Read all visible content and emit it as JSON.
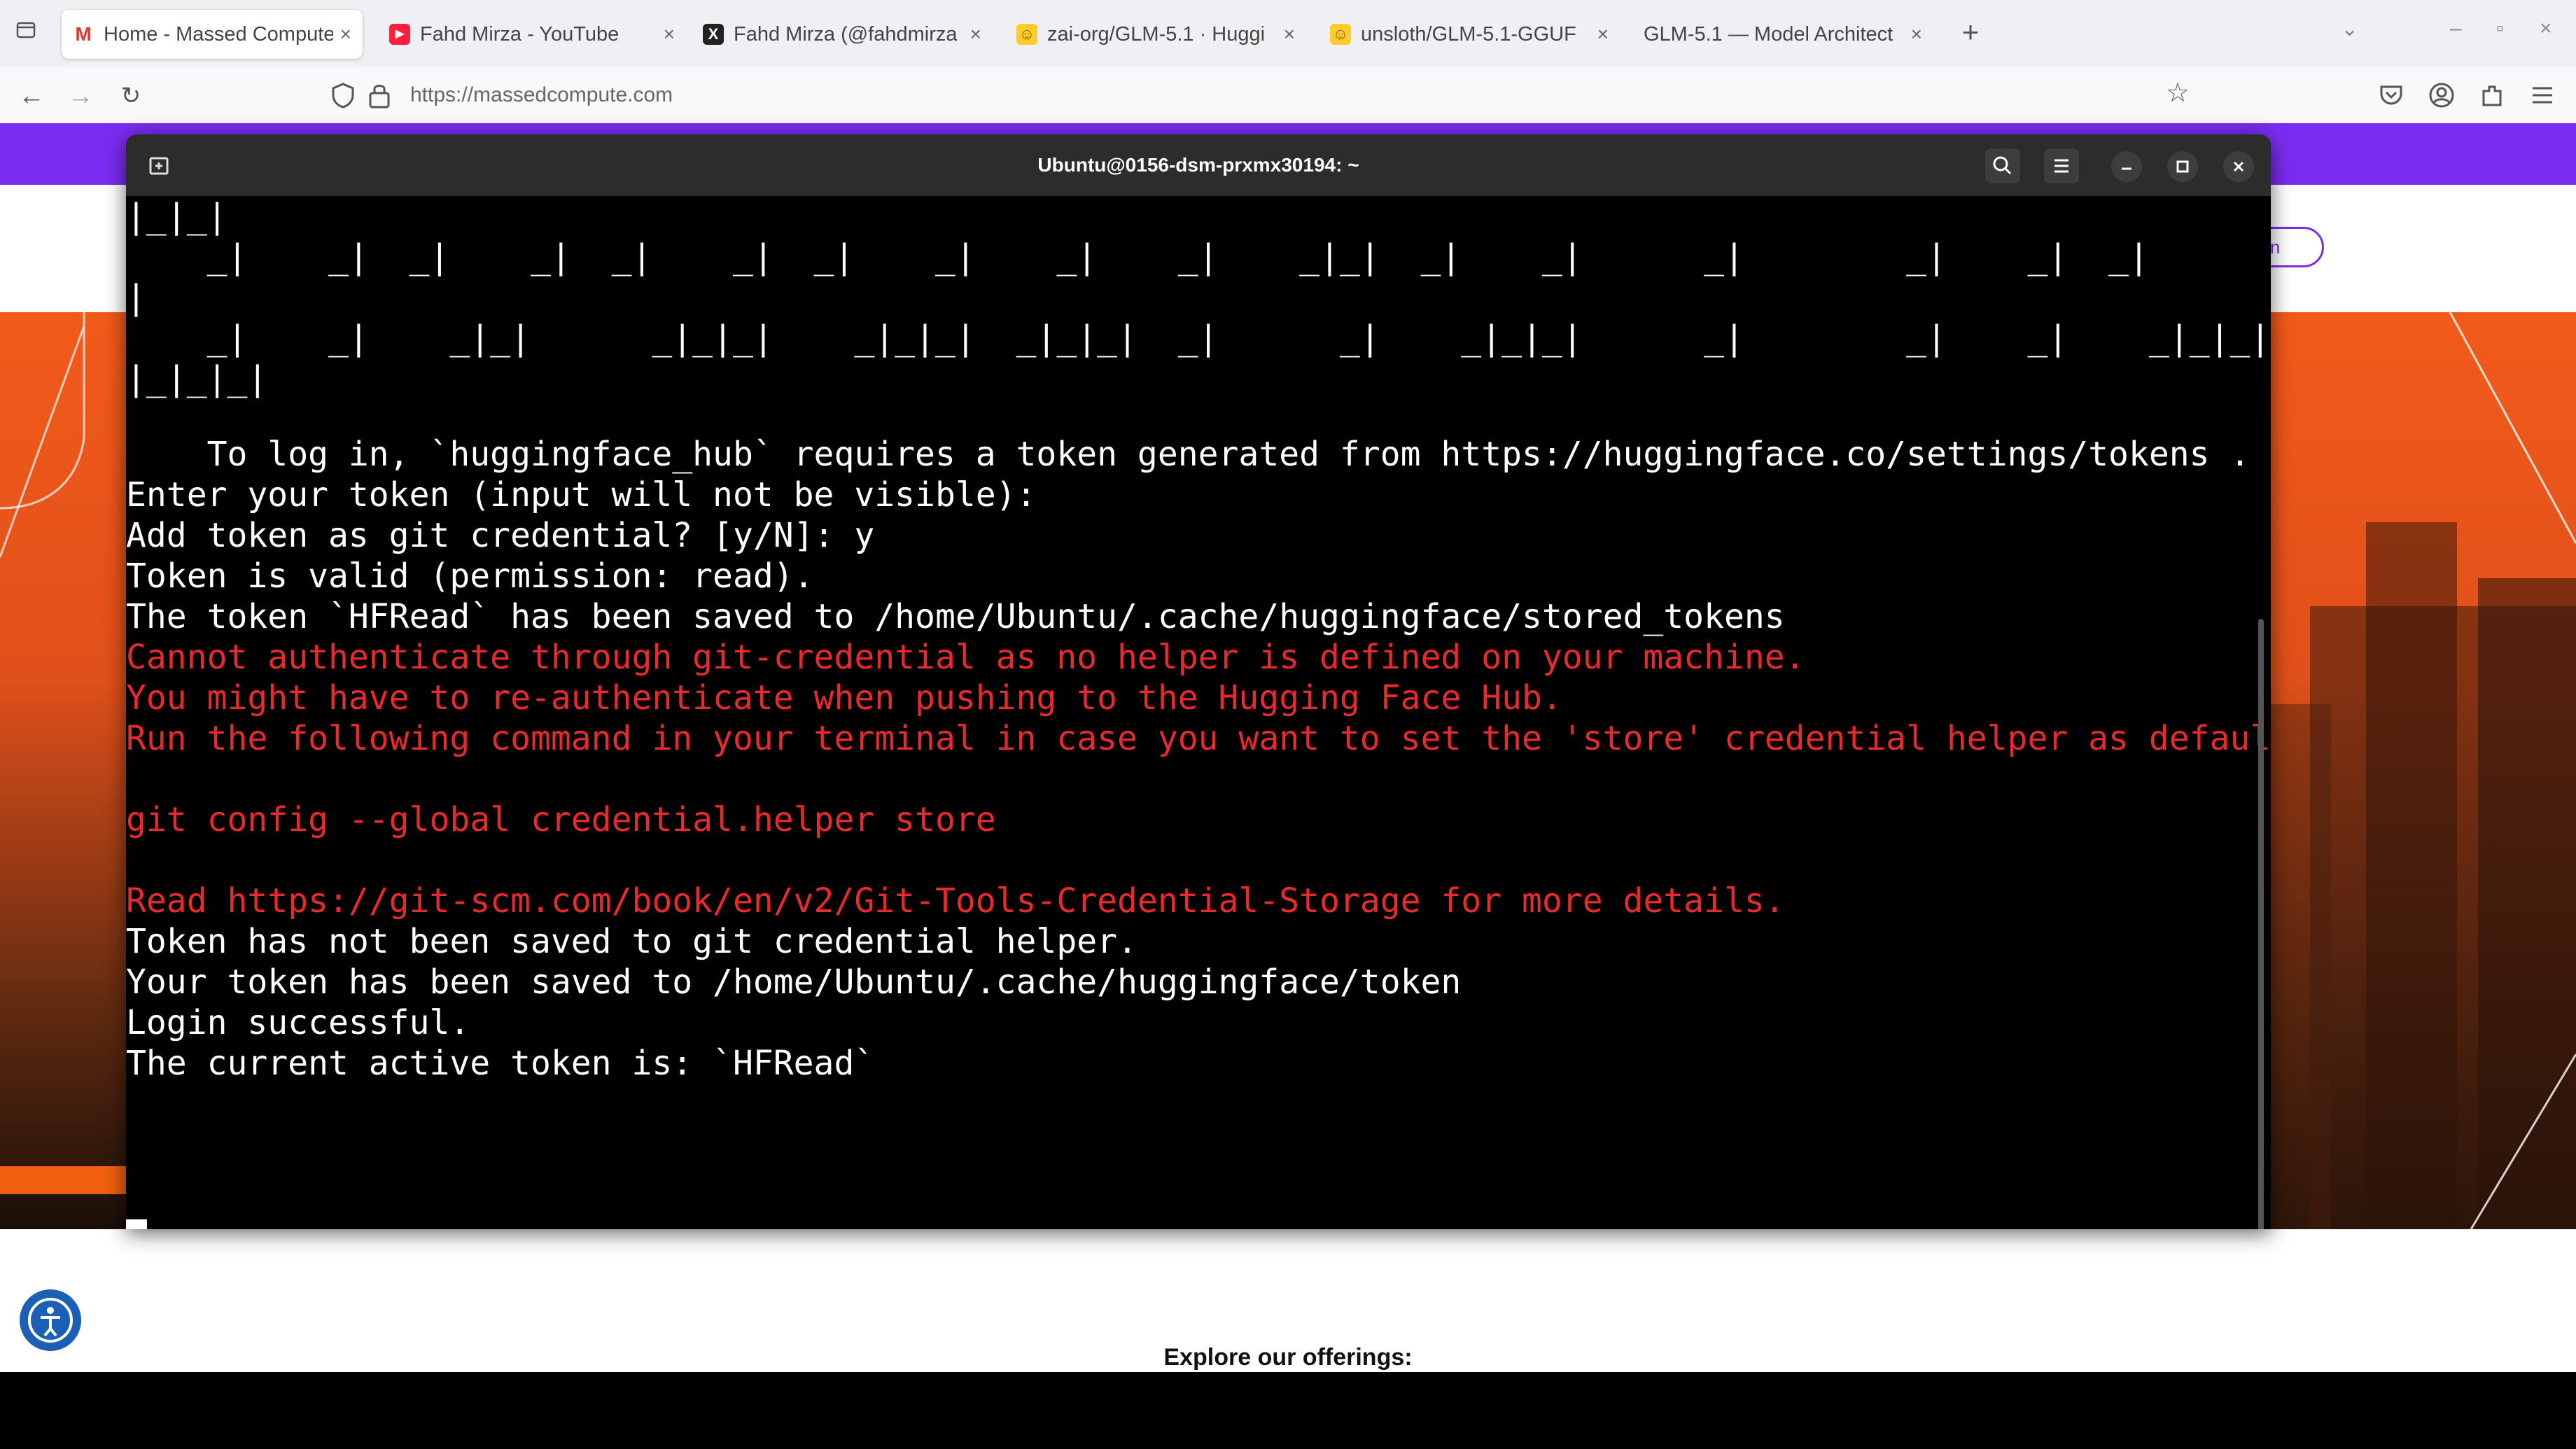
{
  "browser": {
    "tabs": [
      {
        "label": "Home - Massed Compute",
        "favicon": "massed-compute-icon",
        "active": true
      },
      {
        "label": "Fahd Mirza - YouTube",
        "favicon": "youtube-icon",
        "active": false
      },
      {
        "label": "Fahd Mirza (@fahdmirza",
        "favicon": "x-icon",
        "active": false
      },
      {
        "label": "zai-org/GLM-5.1 · Huggi",
        "favicon": "huggingface-icon",
        "active": false
      },
      {
        "label": "unsloth/GLM-5.1-GGUF",
        "favicon": "huggingface-icon",
        "active": false
      },
      {
        "label": "GLM-5.1 — Model Architect",
        "favicon": "",
        "active": false
      }
    ],
    "url": "https://massedcompute.com",
    "accent": "#7b2cf2"
  },
  "site": {
    "login_label": "gin",
    "explore_label": "Explore our offerings:"
  },
  "terminal": {
    "title": "Ubuntu@0156-dsm-prxmx30194: ~",
    "ascii_lines": [
      "|_|_|",
      "    _|    _|  _|    _|  _|    _|  _|    _|    _|    _|    _|_|  _|    _|      _|        _|    _|  _|       _",
      "|",
      "    _|    _|    _|_|      _|_|_|    _|_|_|  _|_|_|  _|      _|    _|_|_|      _|        _|    _|    _|_|_|  _",
      "|_|_|_|"
    ],
    "lines": [
      {
        "text": "    To log in, `huggingface_hub` requires a token generated from https://huggingface.co/settings/tokens .",
        "color": "white"
      },
      {
        "text": "Enter your token (input will not be visible):",
        "color": "white"
      },
      {
        "text": "Add token as git credential? [y/N]: y",
        "color": "white"
      },
      {
        "text": "Token is valid (permission: read).",
        "color": "white"
      },
      {
        "text": "The token `HFRead` has been saved to /home/Ubuntu/.cache/huggingface/stored_tokens",
        "color": "white"
      },
      {
        "text": "Cannot authenticate through git-credential as no helper is defined on your machine.",
        "color": "red"
      },
      {
        "text": "You might have to re-authenticate when pushing to the Hugging Face Hub.",
        "color": "red"
      },
      {
        "text": "Run the following command in your terminal in case you want to set the 'store' credential helper as default.",
        "color": "red"
      },
      {
        "text": "",
        "color": "white"
      },
      {
        "text": "git config --global credential.helper store",
        "color": "red"
      },
      {
        "text": "",
        "color": "white"
      },
      {
        "text": "Read https://git-scm.com/book/en/v2/Git-Tools-Credential-Storage for more details.",
        "color": "red"
      },
      {
        "text": "Token has not been saved to git credential helper.",
        "color": "white"
      },
      {
        "text": "Your token has been saved to /home/Ubuntu/.cache/huggingface/token",
        "color": "white"
      },
      {
        "text": "Login successful.",
        "color": "white"
      },
      {
        "text": "The current active token is: `HFRead`",
        "color": "white"
      }
    ]
  }
}
